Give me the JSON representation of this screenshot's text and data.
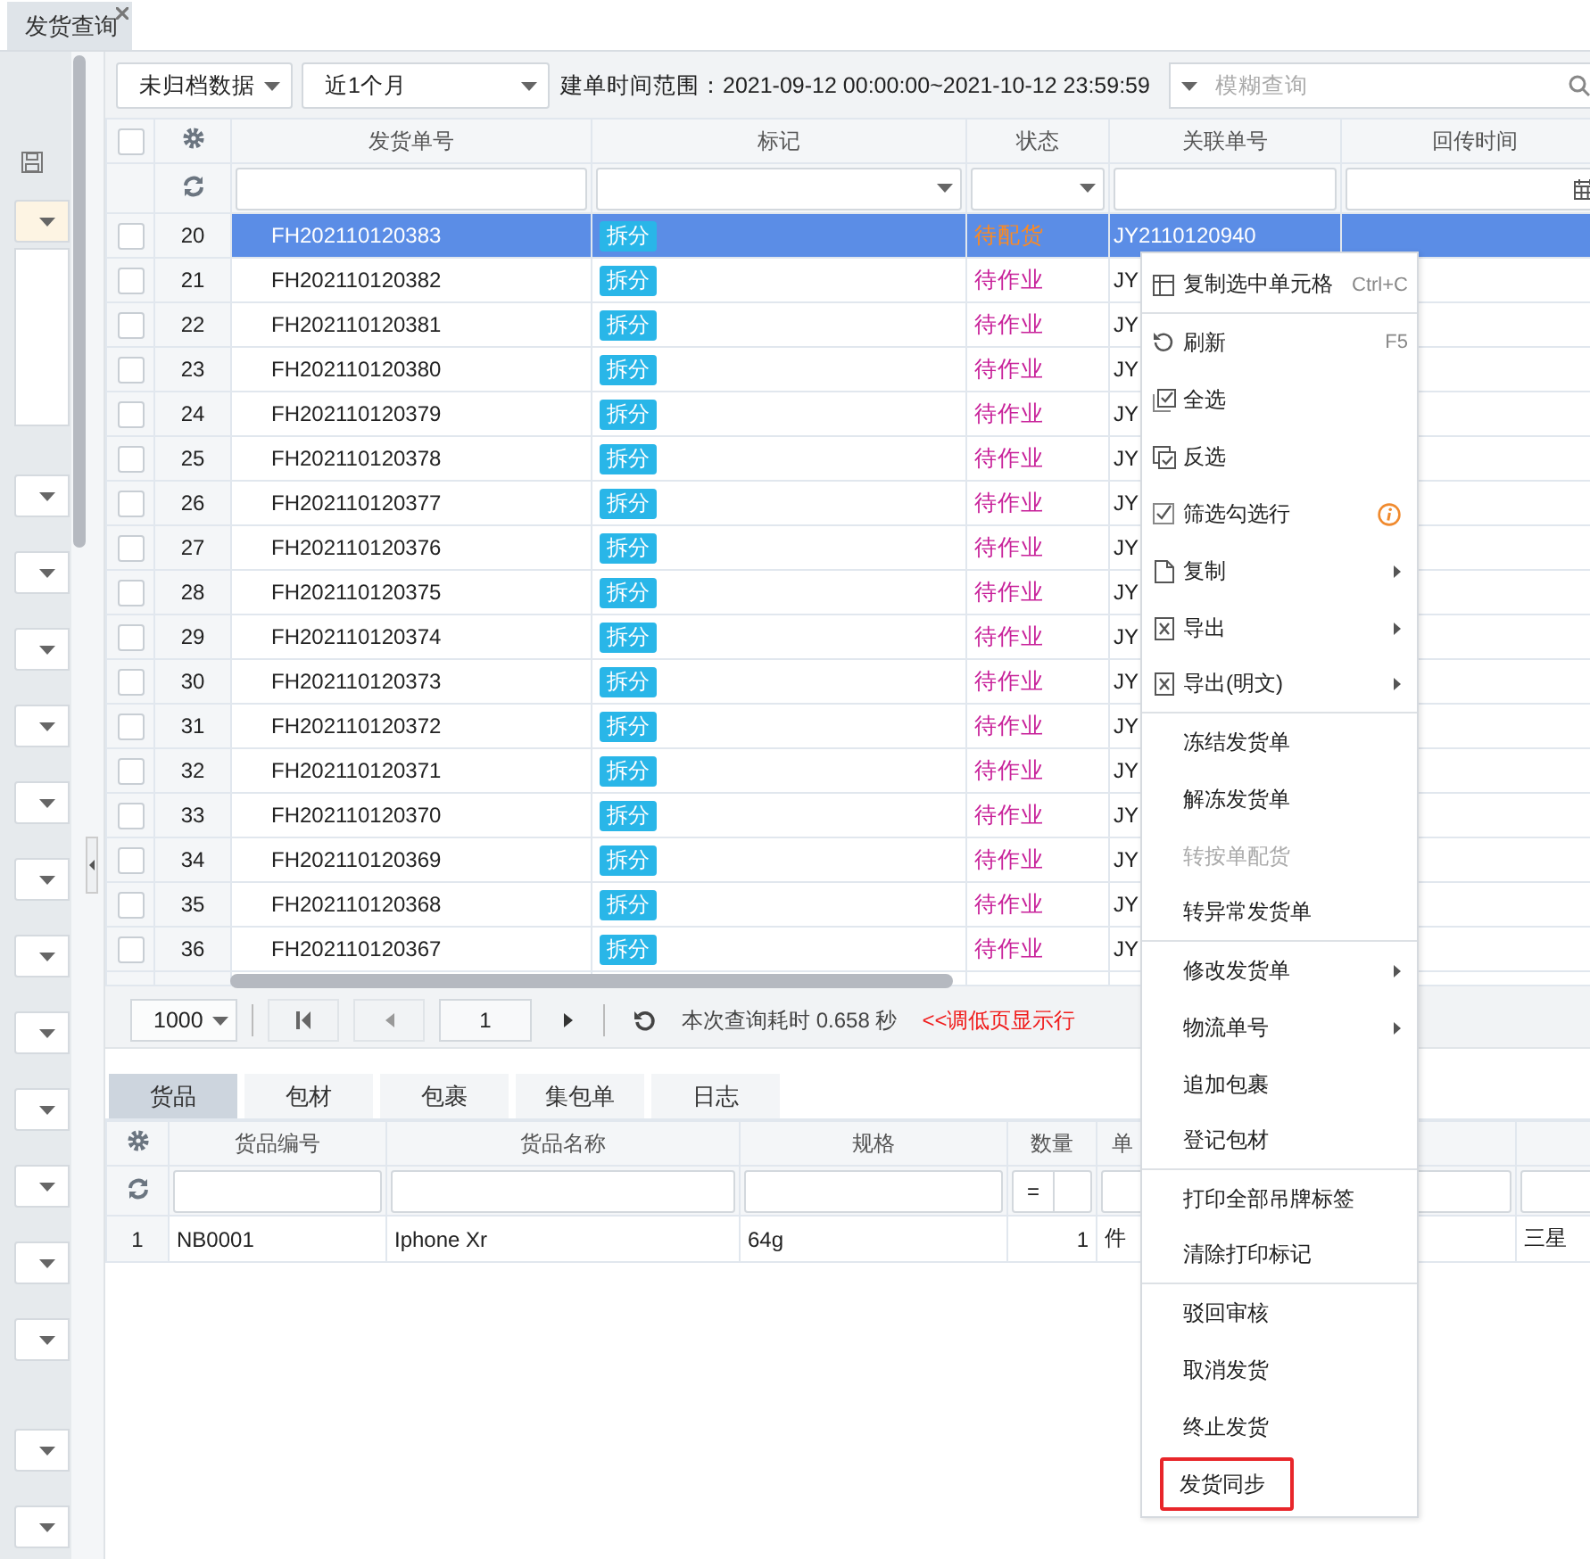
{
  "tab": {
    "title": "发货查询"
  },
  "toolbar": {
    "archive_filter": "未归档数据",
    "period": "近1个月",
    "time_range": "建单时间范围：2021-09-12 00:00:00~2021-10-12 23:59:59",
    "search": {
      "placeholder": "模糊查询"
    }
  },
  "grid": {
    "all_checked": false,
    "columns": [
      "发货单号",
      "标记",
      "状态",
      "关联单号",
      "回传时间"
    ],
    "rows": [
      {
        "no": "20",
        "order": "FH202110120383",
        "tag": "拆分",
        "status": "待配货",
        "color": "#ff8a1e",
        "related": "JY2110120940",
        "selected": true,
        "checked": false
      },
      {
        "no": "21",
        "order": "FH202110120382",
        "tag": "拆分",
        "status": "待作业",
        "color": "#c8229a",
        "related": "JY",
        "selected": false,
        "checked": false
      },
      {
        "no": "22",
        "order": "FH202110120381",
        "tag": "拆分",
        "status": "待作业",
        "color": "#c8229a",
        "related": "JY",
        "selected": false,
        "checked": false
      },
      {
        "no": "23",
        "order": "FH202110120380",
        "tag": "拆分",
        "status": "待作业",
        "color": "#c8229a",
        "related": "JY",
        "selected": false,
        "checked": false
      },
      {
        "no": "24",
        "order": "FH202110120379",
        "tag": "拆分",
        "status": "待作业",
        "color": "#c8229a",
        "related": "JY",
        "selected": false,
        "checked": false
      },
      {
        "no": "25",
        "order": "FH202110120378",
        "tag": "拆分",
        "status": "待作业",
        "color": "#c8229a",
        "related": "JY",
        "selected": false,
        "checked": false
      },
      {
        "no": "26",
        "order": "FH202110120377",
        "tag": "拆分",
        "status": "待作业",
        "color": "#c8229a",
        "related": "JY",
        "selected": false,
        "checked": false
      },
      {
        "no": "27",
        "order": "FH202110120376",
        "tag": "拆分",
        "status": "待作业",
        "color": "#c8229a",
        "related": "JY",
        "selected": false,
        "checked": false
      },
      {
        "no": "28",
        "order": "FH202110120375",
        "tag": "拆分",
        "status": "待作业",
        "color": "#c8229a",
        "related": "JY",
        "selected": false,
        "checked": false
      },
      {
        "no": "29",
        "order": "FH202110120374",
        "tag": "拆分",
        "status": "待作业",
        "color": "#c8229a",
        "related": "JY",
        "selected": false,
        "checked": false
      },
      {
        "no": "30",
        "order": "FH202110120373",
        "tag": "拆分",
        "status": "待作业",
        "color": "#c8229a",
        "related": "JY",
        "selected": false,
        "checked": false
      },
      {
        "no": "31",
        "order": "FH202110120372",
        "tag": "拆分",
        "status": "待作业",
        "color": "#c8229a",
        "related": "JY",
        "selected": false,
        "checked": false
      },
      {
        "no": "32",
        "order": "FH202110120371",
        "tag": "拆分",
        "status": "待作业",
        "color": "#c8229a",
        "related": "JY",
        "selected": false,
        "checked": false
      },
      {
        "no": "33",
        "order": "FH202110120370",
        "tag": "拆分",
        "status": "待作业",
        "color": "#c8229a",
        "related": "JY",
        "selected": false,
        "checked": false
      },
      {
        "no": "34",
        "order": "FH202110120369",
        "tag": "拆分",
        "status": "待作业",
        "color": "#c8229a",
        "related": "JY",
        "selected": false,
        "checked": false
      },
      {
        "no": "35",
        "order": "FH202110120368",
        "tag": "拆分",
        "status": "待作业",
        "color": "#c8229a",
        "related": "JY",
        "selected": false,
        "checked": false
      },
      {
        "no": "36",
        "order": "FH202110120367",
        "tag": "拆分",
        "status": "待作业",
        "color": "#c8229a",
        "related": "JY",
        "selected": false,
        "checked": false
      }
    ]
  },
  "pager": {
    "page_size": "1000",
    "page": "1",
    "timing": "本次查询耗时 0.658 秒",
    "hint": "<<调低页显示行"
  },
  "detail_tabs": [
    {
      "label": "货品",
      "selected": true
    },
    {
      "label": "包材",
      "selected": false
    },
    {
      "label": "包裹",
      "selected": false
    },
    {
      "label": "集包单",
      "selected": false
    },
    {
      "label": "日志",
      "selected": false
    }
  ],
  "detail_grid": {
    "columns": [
      "货品编号",
      "货品名称",
      "规格",
      "数量",
      "单"
    ],
    "quantity_operator": "=",
    "rows": [
      {
        "index": "1",
        "code": "NB0001",
        "name": "Iphone Xr",
        "spec": "64g",
        "qty": "1",
        "unit": "件",
        "column_7": "三星"
      }
    ]
  },
  "context_menu": {
    "items": [
      {
        "kind": "grid",
        "label": "复制选中单元格",
        "shortcut": "Ctrl+C",
        "submenu": false,
        "disabled": false,
        "outlined": false,
        "separator_after": true
      },
      {
        "kind": "refresh",
        "label": "刷新",
        "shortcut": "F5",
        "submenu": false,
        "disabled": false,
        "outlined": false,
        "separator_after": false
      },
      {
        "kind": "selectall",
        "label": "全选",
        "submenu": false,
        "disabled": false,
        "outlined": false,
        "separator_after": false
      },
      {
        "kind": "invert",
        "label": "反选",
        "submenu": false,
        "disabled": false,
        "outlined": false,
        "separator_after": false
      },
      {
        "kind": "filter",
        "label": "筛选勾选行",
        "submenu": false,
        "disabled": false,
        "outlined": false,
        "separator_after": false
      },
      {
        "kind": "copy",
        "label": "复制",
        "submenu": true,
        "disabled": false,
        "outlined": false,
        "separator_after": false
      },
      {
        "kind": "export",
        "label": "导出",
        "submenu": true,
        "disabled": false,
        "outlined": false,
        "separator_after": false
      },
      {
        "kind": "export",
        "label": "导出(明文)",
        "submenu": true,
        "disabled": false,
        "outlined": false,
        "separator_after": true
      },
      {
        "kind": "plain",
        "label": "冻结发货单",
        "submenu": false,
        "disabled": false,
        "outlined": false,
        "separator_after": false
      },
      {
        "kind": "plain",
        "label": "解冻发货单",
        "submenu": false,
        "disabled": false,
        "outlined": false,
        "separator_after": false
      },
      {
        "kind": "plain",
        "label": "转按单配货",
        "submenu": false,
        "disabled": true,
        "outlined": false,
        "separator_after": false
      },
      {
        "kind": "plain",
        "label": "转异常发货单",
        "submenu": false,
        "disabled": false,
        "outlined": false,
        "separator_after": true
      },
      {
        "kind": "plain",
        "label": "修改发货单",
        "submenu": true,
        "disabled": false,
        "outlined": false,
        "separator_after": false
      },
      {
        "kind": "plain",
        "label": "物流单号",
        "submenu": true,
        "disabled": false,
        "outlined": false,
        "separator_after": false
      },
      {
        "kind": "plain",
        "label": "追加包裹",
        "submenu": false,
        "disabled": false,
        "outlined": false,
        "separator_after": false
      },
      {
        "kind": "plain",
        "label": "登记包材",
        "submenu": false,
        "disabled": false,
        "outlined": false,
        "separator_after": true
      },
      {
        "kind": "plain",
        "label": "打印全部吊牌标签",
        "submenu": false,
        "disabled": false,
        "outlined": false,
        "separator_after": false
      },
      {
        "kind": "plain",
        "label": "清除打印标记",
        "submenu": false,
        "disabled": false,
        "outlined": false,
        "separator_after": true
      },
      {
        "kind": "plain",
        "label": "驳回审核",
        "submenu": false,
        "disabled": false,
        "outlined": false,
        "separator_after": false
      },
      {
        "kind": "plain",
        "label": "取消发货",
        "submenu": false,
        "disabled": false,
        "outlined": false,
        "separator_after": false
      },
      {
        "kind": "plain",
        "label": "终止发货",
        "submenu": false,
        "disabled": false,
        "outlined": false,
        "separator_after": false
      },
      {
        "kind": "plain",
        "label": "发货同步",
        "submenu": false,
        "disabled": false,
        "outlined": true,
        "separator_after": false
      }
    ]
  }
}
